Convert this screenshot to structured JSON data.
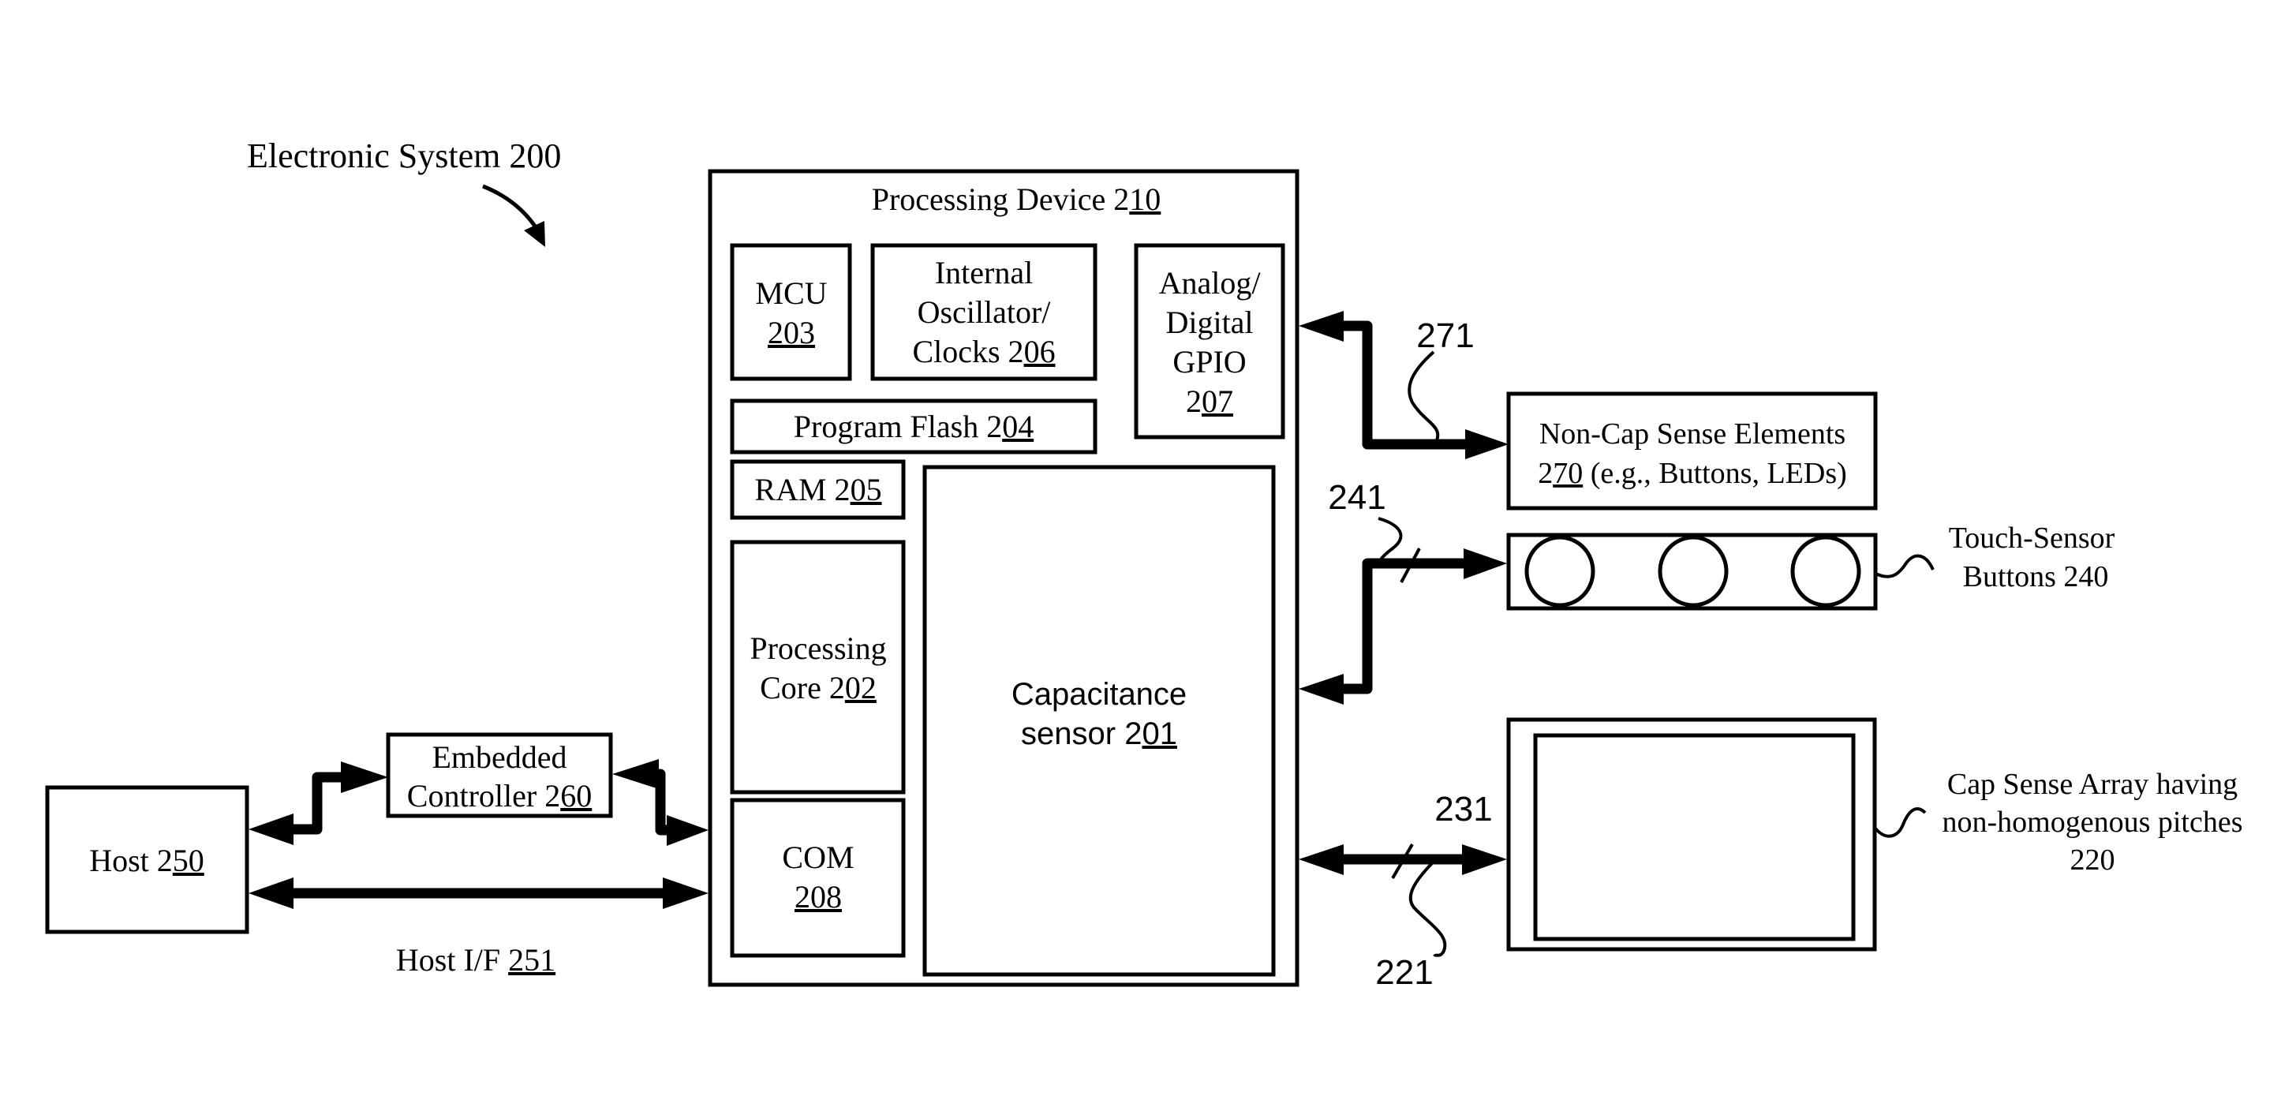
{
  "figure": {
    "title": "Electronic System 200"
  },
  "processing_device": {
    "label_prefix": "Processing Device 2",
    "label_ref": "10",
    "blocks": {
      "mcu": {
        "line1": "MCU",
        "ref": "203"
      },
      "oscillator": {
        "line1": "Internal",
        "line2": "Oscillator/",
        "line3_prefix": "Clocks 2",
        "line3_ref": "06"
      },
      "gpio": {
        "line1": "Analog/",
        "line2": "Digital",
        "line3": "GPIO",
        "line4_prefix": "2",
        "line4_ref": "07"
      },
      "flash": {
        "prefix": "Program Flash 2",
        "ref": "04"
      },
      "ram": {
        "prefix": "RAM 2",
        "ref": "05"
      },
      "core": {
        "line1": "Processing",
        "line2_prefix": "Core 2",
        "line2_ref": "02"
      },
      "com": {
        "line1": "COM",
        "ref": "208"
      },
      "cap_sensor": {
        "line1": "Capacitance",
        "line2_prefix": "sensor 2",
        "line2_ref": "01"
      }
    }
  },
  "host": {
    "prefix": "Host 2",
    "ref": "50"
  },
  "embedded_controller": {
    "line1": "Embedded",
    "line2_prefix": "Controller 2",
    "line2_ref": "60"
  },
  "host_interface": {
    "prefix": "Host I/F ",
    "ref": "251"
  },
  "non_cap": {
    "line1": "Non-Cap Sense Elements",
    "line2_prefix": "2",
    "line2_ref": "70",
    "line2_suffix": " (e.g., Buttons, LEDs)"
  },
  "touch_buttons": {
    "line1": "Touch-Sensor",
    "line2": "Buttons 240",
    "button_count": 3
  },
  "cap_array": {
    "line1": "Cap Sense Array having",
    "line2": "non-homogenous pitches",
    "line3": "220"
  },
  "ref_labels": {
    "bus_non_cap": "271",
    "bus_touch": "241",
    "bus_array": "231",
    "bus_array_lines": "221"
  }
}
